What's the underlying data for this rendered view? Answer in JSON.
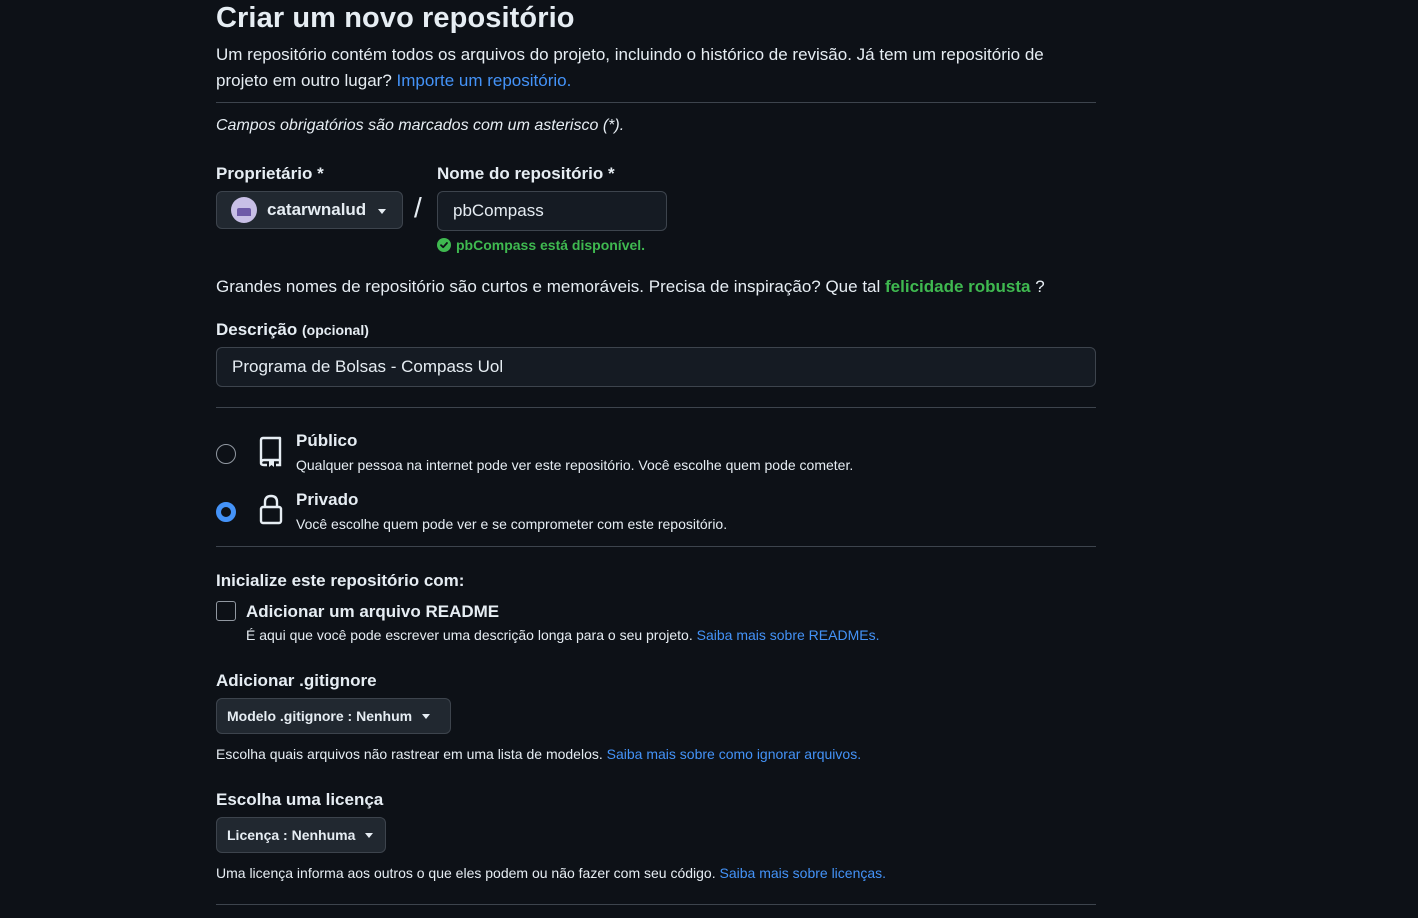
{
  "header": {
    "title": "Criar um novo repositório",
    "intro": "Um repositório contém todos os arquivos do projeto, incluindo o histórico de revisão. Já tem um repositório de projeto em outro lugar?",
    "import_link": "Importe um repositório."
  },
  "required_note": "Campos obrigatórios são marcados com um asterisco (*).",
  "owner": {
    "label": "Proprietário *",
    "value": "catarwnalud"
  },
  "separator": "/",
  "repo_name": {
    "label": "Nome do repositório *",
    "value": "pbCompass",
    "availability": "pbCompass está disponível."
  },
  "name_hint": {
    "text": "Grandes nomes de repositório são curtos e memoráveis. Precisa de inspiração? Que tal",
    "suggestion": "felicidade robusta",
    "suffix": "?"
  },
  "description": {
    "label": "Descrição",
    "optional": "(opcional)",
    "value": "Programa de Bolsas - Compass Uol"
  },
  "visibility": {
    "public": {
      "title": "Público",
      "desc": "Qualquer pessoa na internet pode ver este repositório. Você escolhe quem pode cometer.",
      "selected": false,
      "icon": "repo-icon"
    },
    "private": {
      "title": "Privado",
      "desc": "Você escolhe quem pode ver e se comprometer com este repositório.",
      "selected": true,
      "icon": "lock-icon"
    }
  },
  "init": {
    "heading": "Inicialize este repositório com:",
    "readme_label": "Adicionar um arquivo README",
    "readme_checked": false,
    "readme_desc": "É aqui que você pode escrever uma descrição longa para o seu projeto.",
    "readme_link": "Saiba mais sobre READMEs."
  },
  "gitignore": {
    "heading": "Adicionar .gitignore",
    "dropdown": "Modelo .gitignore : Nenhum",
    "desc": "Escolha quais arquivos não rastrear em uma lista de modelos.",
    "link": "Saiba mais sobre como ignorar arquivos."
  },
  "license": {
    "heading": "Escolha uma licença",
    "dropdown": "Licença : Nenhuma",
    "desc": "Uma licença informa aos outros o que eles podem ou não fazer com seu código.",
    "link": "Saiba mais sobre licenças."
  },
  "colors": {
    "background": "#0d1117",
    "text": "#e6edf3",
    "link": "#4493f8",
    "success": "#3fb950",
    "border": "#3d444d"
  }
}
